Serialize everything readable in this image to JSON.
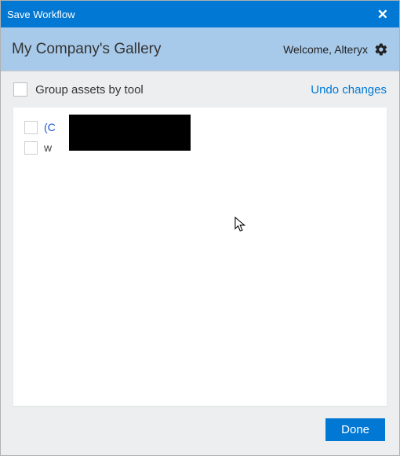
{
  "titlebar": {
    "title": "Save Workflow",
    "close": "✕"
  },
  "subheader": {
    "title": "My Company's Gallery",
    "welcome_label": "Welcome,",
    "username": "Alteryx"
  },
  "controls": {
    "group_assets_label": "Group assets by tool",
    "undo_label": "Undo changes"
  },
  "assets": [
    {
      "label": "(C",
      "style": "blue"
    },
    {
      "label": "w",
      "style": "plain"
    }
  ],
  "footer": {
    "done_label": "Done"
  }
}
